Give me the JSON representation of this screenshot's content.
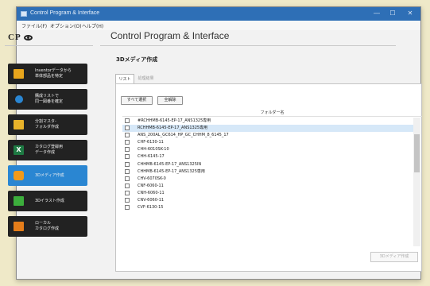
{
  "window": {
    "title": "Control Program & Interface",
    "controls": {
      "minimize": "—",
      "maximize": "☐",
      "close": "✕"
    }
  },
  "menu": [
    "ファイル(F)",
    "オプション(O)",
    "ヘルプ(H)"
  ],
  "logo": {
    "text_left": "CP"
  },
  "app_title": "Control Program & Interface",
  "sidebar": {
    "items": [
      {
        "label": "Inventorデータから\n単体部品を特定",
        "icon": "inventor-icon",
        "color": "#e8a51c",
        "active": false
      },
      {
        "label": "購成リストで\n同一図番を確定",
        "icon": "circle-list-icon",
        "color": "#2a86d2",
        "active": false
      },
      {
        "label": "分割マスタ-\nフォルダ作成",
        "icon": "folder-icon",
        "color": "#e8b22a",
        "active": false
      },
      {
        "label": "カタログ登録用\nデータ作成",
        "icon": "excel-icon",
        "color": "#1e7a43",
        "active": false
      },
      {
        "label": "3Dメディア作成",
        "icon": "3d-media-icon",
        "color": "#f29a1a",
        "active": true
      },
      {
        "label": "3Dイラスト作成",
        "icon": "illustration-icon",
        "color": "#3cae3c",
        "active": false
      },
      {
        "label": "ローカル\nカタログ作成",
        "icon": "catalog-icon",
        "color": "#e57d1a",
        "active": false
      }
    ]
  },
  "main": {
    "section_title": "3Dメディア作成",
    "tabs": [
      {
        "label": "リスト",
        "active": true
      },
      {
        "label": "処理結果",
        "active": false
      }
    ],
    "select_all_label": "すべて選択",
    "deselect_all_label": "全解除",
    "column_header": "フォルダー名",
    "rows": [
      {
        "text": "#RCHHMB-6145-EP-17_ANS1325専用",
        "selected": false
      },
      {
        "text": "RCHHMB-6145-EP-17_ANS1325専用",
        "selected": true
      },
      {
        "text": "ANS_200AL_GC614_HP_GC_CHHM_8_6145_17",
        "selected": false
      },
      {
        "text": "CHF-6130-11",
        "selected": false
      },
      {
        "text": "CHH-6010SK-10",
        "selected": false
      },
      {
        "text": "CHH-6145-17",
        "selected": false
      },
      {
        "text": "CHHMB-6145-EP-17_ANS1325IN",
        "selected": false
      },
      {
        "text": "CHHMB-6145-EP-17_ANS1325専用",
        "selected": false
      },
      {
        "text": "CHV-6070SK-0",
        "selected": false
      },
      {
        "text": "CNF-6060-11",
        "selected": false
      },
      {
        "text": "CNH-6060-11",
        "selected": false
      },
      {
        "text": "CNV-6060-11",
        "selected": false
      },
      {
        "text": "CVF-6130-15",
        "selected": false
      }
    ],
    "create_button_label": "3Dメディア作成"
  }
}
